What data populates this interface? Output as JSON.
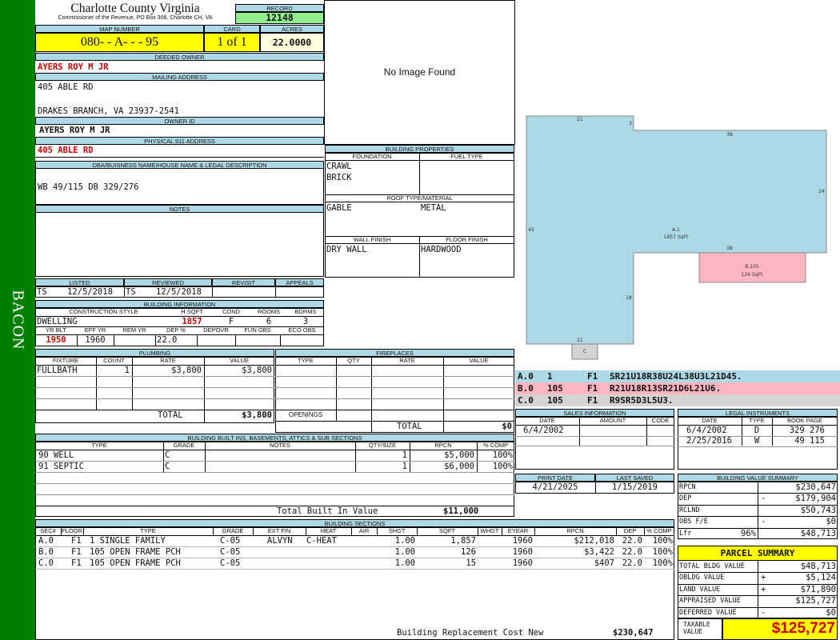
{
  "sidebar": {
    "label": "BACON"
  },
  "header": {
    "county": "Charlotte County Virginia",
    "commissioner": "Commissioner of the Revenue, PO Box 308, Charlotte CH, VA",
    "record_label": "RECORD",
    "record": "12148",
    "map_number_label": "MAP NUMBER",
    "map_number": "080- - A- - - 95",
    "card_label": "CARD",
    "card": "1 of 1",
    "acres_label": "ACRES",
    "acres": "22.0000"
  },
  "owner": {
    "deeded_owner_label": "DEEDED OWNER",
    "deeded_owner": "AYERS ROY M JR",
    "mailing_label": "MAILING ADDRESS",
    "mailing_line1": "405 ABLE RD",
    "mailing_line2": "DRAKES BRANCH, VA 23937-2541",
    "owner_id_label": "OWNER ID",
    "owner_id": "AYERS ROY M JR",
    "physical_label": "PHYSICAL 911 ADDRESS",
    "physical": "405 ABLE RD",
    "dba_label": "DBA/BUISNESS NAME/HOUSE NAME & LEGAL DESCRIPTION",
    "dba": "WB 49/115 DB 329/276",
    "notes_label": "NOTES"
  },
  "image": {
    "text": "No Image Found"
  },
  "building_properties": {
    "title": "BUILDING PROPERTIES",
    "foundation_label": "FOUNDATION",
    "fuel_label": "FUEL TYPE",
    "foundation": [
      "CRAWL",
      "BRICK"
    ],
    "roof_label": "ROOF TYPE/MATERIAL",
    "roof_type": "GABLE",
    "roof_material": "METAL",
    "wall_label": "WALL FINISH",
    "floor_label": "FLOOR FINISH",
    "wall": "DRY WALL",
    "floor": "HARDWOOD"
  },
  "listing": {
    "listed_label": "LISTED",
    "reviewed_label": "REVIEWED",
    "revisit_label": "REVISIT",
    "appeals_label": "APPEALS",
    "listed_by": "TS",
    "listed_date": "12/5/2018",
    "reviewed_by": "TS",
    "reviewed_date": "12/5/2018"
  },
  "building_info": {
    "title": "BUILDING INFORMATION",
    "style_label": "CONSTRUCTION STYLE",
    "hsqft_label": "H SQFT",
    "cond_label": "COND",
    "rooms_label": "ROOMS",
    "bdrms_label": "BDRMS",
    "style": "DWELLING",
    "hsqft": "1857",
    "cond": "F",
    "rooms": "6",
    "bdrms": "3",
    "yrblt_label": "YR BLT",
    "effyr_label": "EFF YR",
    "remyr_label": "REM YR",
    "dep_label": "DEP %",
    "depovr_label": "DEPOVR",
    "funobs_label": "FUN OBS",
    "ecoobs_label": "ECO OBS",
    "yrblt": "1950",
    "effyr": "1960",
    "dep": "22.0"
  },
  "plumbing": {
    "title": "PLUMBING",
    "cols": [
      "FIXTURE",
      "COUNT",
      "RATE",
      "VALUE"
    ],
    "rows": [
      [
        "FULLBATH",
        "1",
        "$3,800",
        "$3,800"
      ]
    ],
    "total_label": "TOTAL",
    "total": "$3,800"
  },
  "fireplaces": {
    "title": "FIREPLACES",
    "cols": [
      "TYPE",
      "QTY",
      "RATE",
      "VALUE"
    ],
    "openings_label": "OPENINGS",
    "total_label": "TOTAL",
    "total": "$0"
  },
  "built_ins": {
    "title": "BUILDING BUILT INS, BASEMENTS, ATTICS & SUB SECTIONS",
    "cols": [
      "TYPE",
      "GRADE",
      "NOTES",
      "QTY/SIZE",
      "RPCN",
      "% COMP"
    ],
    "rows": [
      [
        "90 WELL",
        "C",
        "",
        "1",
        "$5,000",
        "100%"
      ],
      [
        "91 SEPTIC",
        "C",
        "",
        "1",
        "$6,000",
        "100%"
      ]
    ],
    "total_label": "Total Built In Value",
    "total": "$11,000"
  },
  "sections": {
    "title": "BUILDING SECTIONS",
    "cols": [
      "SEC#",
      "FLOOR",
      "TYPE",
      "GRADE",
      "EXT FIN",
      "HEAT",
      "AIR",
      "SHGT",
      "SQFT",
      "WHGT",
      "EYEAR",
      "RPCN",
      "DEP",
      "% COMP"
    ],
    "rows": [
      [
        "A.0",
        "F1",
        "1 SINGLE FAMILY",
        "C-05",
        "ALVYN",
        "C-HEAT",
        "",
        "1.00",
        "1,857",
        "",
        "1960",
        "$212,018",
        "22.0",
        "100%"
      ],
      [
        "B.0",
        "F1",
        "105 OPEN FRAME PCH",
        "C-05",
        "",
        "",
        "",
        "1.00",
        "126",
        "",
        "1960",
        "$3,422",
        "22.0",
        "100%"
      ],
      [
        "C.0",
        "F1",
        "105 OPEN FRAME PCH",
        "C-05",
        "",
        "",
        "",
        "1.00",
        "15",
        "",
        "1960",
        "$407",
        "22.0",
        "100%"
      ]
    ],
    "replacement_label": "Building Replacement Cost New",
    "replacement": "$230,647"
  },
  "sketch": {
    "labels": [
      "21",
      "3",
      "38",
      "24",
      "45",
      "38",
      "18",
      "21"
    ],
    "a_label": "A.1",
    "a_sqft": "1857 SqFt",
    "b_label": "B.105",
    "b_sqft": "126 SqFt",
    "c_label": "C",
    "colors": {
      "a": "#add8e6",
      "b": "#ffb6c1",
      "c": "#d3d3d3"
    },
    "vectors": [
      {
        "sec": "A.0",
        "a": "1",
        "f": "F1",
        "v": "SR21U18R38U24L38U3L21D45."
      },
      {
        "sec": "B.0",
        "a": "105",
        "f": "F1",
        "v": "R21U18R13SR21D6L21U6."
      },
      {
        "sec": "C.0",
        "a": "105",
        "f": "F1",
        "v": "R9SR5D3L5U3."
      }
    ]
  },
  "sales": {
    "title": "SALES INFORMATION",
    "cols": [
      "DATE",
      "AMOUNT",
      "CODE"
    ],
    "rows": [
      [
        "6/4/2002",
        "",
        ""
      ]
    ]
  },
  "legal": {
    "title": "LEGAL INSTRUMENTS",
    "cols": [
      "DATE",
      "TYPE",
      "BOOK PAGE"
    ],
    "rows": [
      [
        "6/4/2002",
        "D",
        "329 276"
      ],
      [
        "2/25/2016",
        "W",
        "49 115"
      ]
    ]
  },
  "dates": {
    "print_label": "PRINT DATE",
    "print": "4/21/2025",
    "saved_label": "LAST SAVED",
    "saved": "1/15/2019"
  },
  "value_summary": {
    "title": "BUILDING VALUE SUMMARY",
    "rows": [
      {
        "label": "RPCN",
        "pct": "",
        "sign": "",
        "value": "$230,647"
      },
      {
        "label": "DEP",
        "pct": "",
        "sign": "-",
        "value": "$179,904"
      },
      {
        "label": "RCLND",
        "pct": "",
        "sign": "",
        "value": "$50,743"
      },
      {
        "label": "OBS F/E",
        "pct": "",
        "sign": "-",
        "value": "$0"
      },
      {
        "label": "Lfr",
        "pct": "96%",
        "sign": "",
        "value": "$48,713"
      }
    ]
  },
  "parcel": {
    "title": "PARCEL SUMMARY",
    "rows": [
      {
        "label": "TOTAL BLDG VALUE",
        "sign": "",
        "value": "$48,713"
      },
      {
        "label": "OBLDG VALUE",
        "sign": "+",
        "value": "$5,124"
      },
      {
        "label": "LAND VALUE",
        "sign": "+",
        "value": "$71,890"
      },
      {
        "label": "APPRAISED VALUE",
        "sign": "",
        "value": "$125,727"
      },
      {
        "label": "DEFERRED VALUE",
        "sign": "-",
        "value": "$0"
      }
    ],
    "taxable_label": "TAXABLE VALUE",
    "taxable": "$125,727"
  }
}
